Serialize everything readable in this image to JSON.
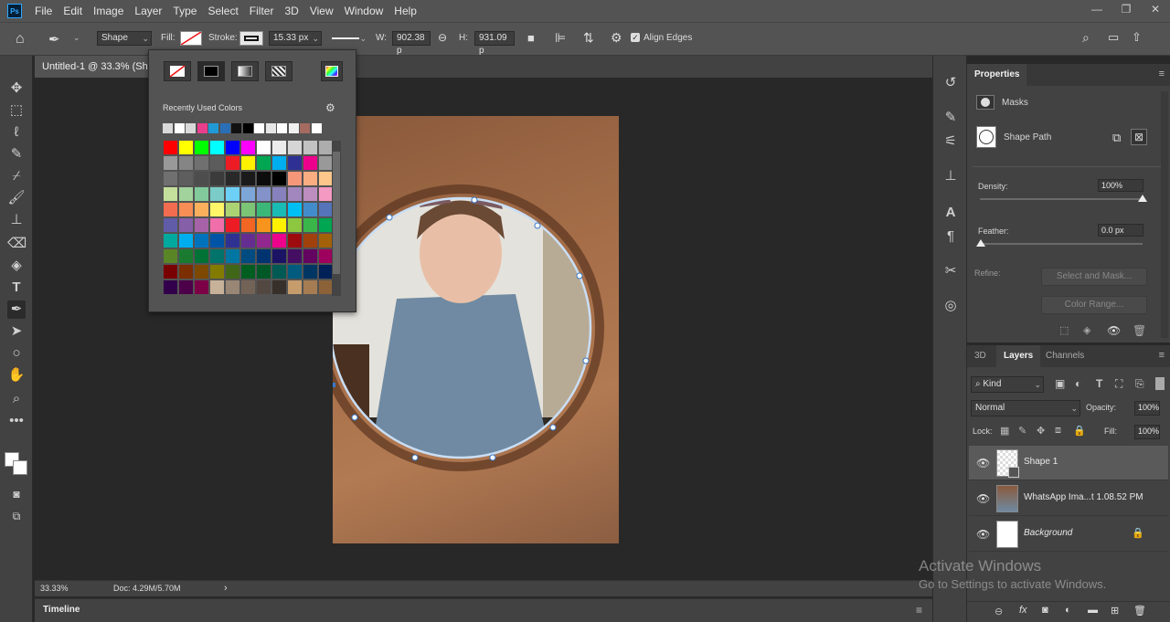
{
  "app": {
    "logo": "Ps"
  },
  "menu": [
    "File",
    "Edit",
    "Image",
    "Layer",
    "Type",
    "Select",
    "Filter",
    "3D",
    "View",
    "Window",
    "Help"
  ],
  "window_controls": [
    "—",
    "❐",
    "✕"
  ],
  "options_bar": {
    "mode": "Shape",
    "fill_label": "Fill:",
    "stroke_label": "Stroke:",
    "stroke_width": "15.33 px",
    "w_label": "W:",
    "w_value": "902.38 p",
    "link_glyph": "⊖",
    "h_label": "H:",
    "h_value": "931.09 p",
    "align_edges_label": "Align Edges",
    "align_edges_checked": true
  },
  "document_tab": {
    "title": "Untitled-1 @ 33.3% (Sh"
  },
  "fill_popup": {
    "recent_label": "Recently Used Colors",
    "recent_colors": [
      "#d9d9d9",
      "#ffffff",
      "#d9d9d9",
      "#e83e8c",
      "#1f9ad6",
      "#2a6fb5",
      "#111111",
      "#000000",
      "#ffffff",
      "#e6e6e6",
      "#ffffff",
      "#f0f0f0",
      "#a56b60",
      "#ffffff"
    ],
    "swatches": [
      [
        "#ff0000",
        "#ffff00",
        "#00ff00",
        "#00ffff",
        "#0000ff",
        "#ff00ff",
        "#ffffff",
        "#ebebeb",
        "#d6d6d6",
        "#c2c2c2",
        "#adadad"
      ],
      [
        "#999999",
        "#858585",
        "#707070",
        "#5c5c5c",
        "#ed1c24",
        "#fff200",
        "#00a651",
        "#00aeef",
        "#2e3192",
        "#ec008c",
        "#999999"
      ],
      [
        "#707070",
        "#5e5e5e",
        "#4d4d4d",
        "#3b3b3b",
        "#292929",
        "#1a1a1a",
        "#0d0d0d",
        "#000000",
        "#f7977a",
        "#f9ad81",
        "#fdc68a"
      ],
      [
        "#c4df9b",
        "#a3d39c",
        "#82ca9c",
        "#7accc8",
        "#6dcff6",
        "#7da7d9",
        "#8393ca",
        "#8781bd",
        "#a187be",
        "#bc8dbf",
        "#f49ac2"
      ],
      [
        "#f26c4f",
        "#f68e56",
        "#fbaf5d",
        "#fff568",
        "#acd373",
        "#7cc576",
        "#3bb878",
        "#1abbb4",
        "#00bff3",
        "#438ccb",
        "#5574b9"
      ],
      [
        "#605ca8",
        "#855fa8",
        "#a763a8",
        "#f06eaa",
        "#ed1c24",
        "#f26522",
        "#f7941d",
        "#fff200",
        "#8dc63f",
        "#39b54a",
        "#00a651"
      ],
      [
        "#00a99d",
        "#00aeef",
        "#0072bc",
        "#0054a6",
        "#2e3192",
        "#662d91",
        "#92278f",
        "#ec008c",
        "#9e0b0f",
        "#a0410d",
        "#a36209"
      ],
      [
        "#598527",
        "#1a7b30",
        "#007236",
        "#00746b",
        "#0076a3",
        "#004b80",
        "#003471",
        "#1b1464",
        "#440e62",
        "#630460",
        "#9e005d"
      ],
      [
        "#790000",
        "#7b2e00",
        "#7d4900",
        "#827b00",
        "#406618",
        "#005e20",
        "#005826",
        "#005952",
        "#005b7f",
        "#003663",
        "#002157"
      ],
      [
        "#32004b",
        "#4b0049",
        "#7b0046",
        "#c7b299",
        "#998675",
        "#736357",
        "#534741",
        "#37302a",
        "#c69c6d",
        "#a67c52",
        "#8c6239"
      ]
    ]
  },
  "status": {
    "zoom": "33.33%",
    "doc": "Doc: 4.29M/5.70M",
    "arrow": "›"
  },
  "timeline_label": "Timeline",
  "properties": {
    "tab": "Properties",
    "masks_label": "Masks",
    "shape_path_label": "Shape Path",
    "density_label": "Density:",
    "density_value": "100%",
    "density_pct": 100,
    "feather_label": "Feather:",
    "feather_value": "0.0 px",
    "refine_label": "Refine:",
    "select_mask_btn": "Select and Mask...",
    "color_range_btn": "Color Range..."
  },
  "layers_panel": {
    "tabs": [
      "3D",
      "Layers",
      "Channels"
    ],
    "kind_label": "Kind",
    "blend_mode": "Normal",
    "opacity_label": "Opacity:",
    "opacity_value": "100%",
    "lock_label": "Lock:",
    "fill_label": "Fill:",
    "fill_value": "100%",
    "layers": [
      {
        "name": "Shape 1",
        "selected": true
      },
      {
        "name": "WhatsApp Ima...t 1.08.52 PM",
        "selected": false
      },
      {
        "name": "Background",
        "selected": false,
        "italic": true,
        "locked": true
      }
    ]
  },
  "watermark": {
    "line1": "Activate Windows",
    "line2": "Go to Settings to activate Windows."
  }
}
